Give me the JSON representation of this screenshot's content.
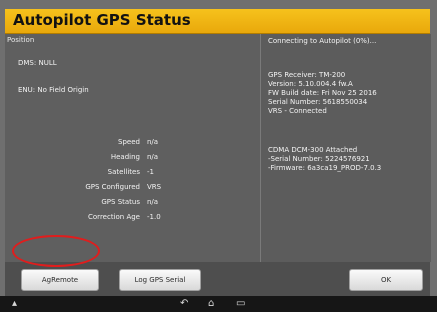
{
  "window": {
    "title": "Autopilot GPS Status"
  },
  "left": {
    "section_label": "Position",
    "dms": "DMS: NULL",
    "enu": "ENU: No Field Origin",
    "fields": [
      {
        "label": "Speed",
        "value": "n/a"
      },
      {
        "label": "Heading",
        "value": "n/a"
      },
      {
        "label": "Satellites",
        "value": "-1"
      },
      {
        "label": "GPS Configured",
        "value": "VRS"
      },
      {
        "label": "GPS Status",
        "value": "n/a"
      },
      {
        "label": "Correction Age",
        "value": "-1.0"
      }
    ]
  },
  "right": {
    "connecting": "Connecting to Autopilot (0%)...",
    "receiver_lines": [
      "GPS Receiver: TM-200",
      "Version: 5.10.004.4 fw.A",
      "FW Build date: Fri Nov 25 2016",
      "Serial Number: 5618550034",
      "VRS - Connected"
    ],
    "modem_lines": [
      "CDMA DCM-300 Attached",
      "-Serial Number: 5224576921",
      "-Firmware: 6a3ca19_PROD-7.0.3"
    ]
  },
  "buttons": {
    "agremote": "AgRemote",
    "log_gps_serial": "Log GPS Serial",
    "ok": "OK"
  },
  "navbar": {
    "back_icon": "back-icon",
    "home_icon": "home-icon",
    "recents_icon": "recents-icon",
    "menu_icon": "menu-icon"
  },
  "colors": {
    "title_bar": "#f0b414",
    "highlight_circle": "#e01d1d"
  }
}
